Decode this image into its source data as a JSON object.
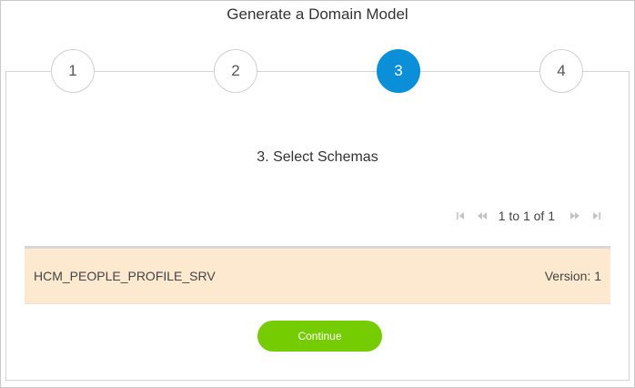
{
  "dialog": {
    "title": "Generate a Domain Model"
  },
  "wizard": {
    "steps": [
      {
        "label": "1",
        "active": false
      },
      {
        "label": "2",
        "active": false
      },
      {
        "label": "3",
        "active": true
      },
      {
        "label": "4",
        "active": false
      }
    ],
    "step_title": "3. Select Schemas"
  },
  "pager": {
    "text": "1 to 1 of 1",
    "icons": [
      "first-page-icon",
      "previous-page-icon",
      "next-page-icon",
      "last-page-icon"
    ]
  },
  "schemas": [
    {
      "name": "HCM_PEOPLE_PROFILE_SRV",
      "version": "Version: 1"
    }
  ],
  "actions": {
    "continue_label": "Continue"
  },
  "colors": {
    "active_step": "#0a8fd8",
    "selected_row": "#fde9d0",
    "continue_button": "#75cc00"
  }
}
